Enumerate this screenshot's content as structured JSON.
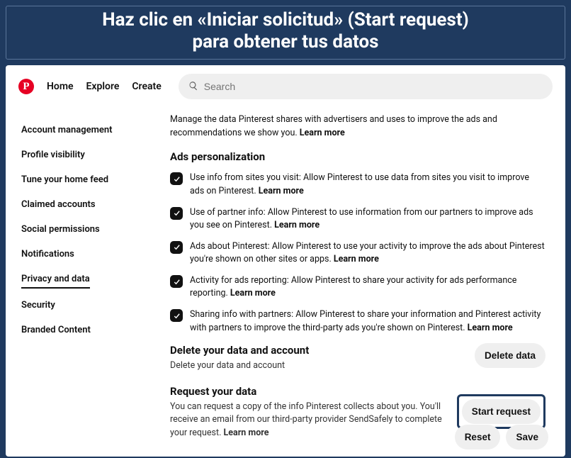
{
  "banner": {
    "line1": "Haz clic en «Iniciar solicitud» (Start request)",
    "line2": "para obtener tus datos"
  },
  "nav": {
    "home": "Home",
    "explore": "Explore",
    "create": "Create",
    "search_placeholder": "Search"
  },
  "sidebar": {
    "items": [
      {
        "label": "Account management"
      },
      {
        "label": "Profile visibility"
      },
      {
        "label": "Tune your home feed"
      },
      {
        "label": "Claimed accounts"
      },
      {
        "label": "Social permissions"
      },
      {
        "label": "Notifications"
      },
      {
        "label": "Privacy and data",
        "active": true
      },
      {
        "label": "Security"
      },
      {
        "label": "Branded Content"
      }
    ]
  },
  "content": {
    "intro": "Manage the data Pinterest shares with advertisers and uses to improve the ads and recommendations we show you.",
    "learn_more": "Learn more",
    "ads_h": "Ads personalization",
    "opts": [
      "Use info from sites you visit: Allow Pinterest to use data from sites you visit to improve ads on Pinterest.",
      "Use of partner info: Allow Pinterest to use information from our partners to improve ads you see on Pinterest.",
      "Ads about Pinterest: Allow Pinterest to use your activity to improve the ads about Pinterest you're shown on other sites or apps.",
      "Activity for ads reporting: Allow Pinterest to share your activity for ads performance reporting.",
      "Sharing info with partners: Allow Pinterest to share your information and Pinterest activity with partners to improve the third-party ads you're shown on Pinterest."
    ],
    "delete_h": "Delete your data and account",
    "delete_sub": "Delete your data and account",
    "delete_btn": "Delete data",
    "request_h": "Request your data",
    "request_desc": "You can request a copy of the info Pinterest collects about you. You'll receive an email from our third-party provider SendSafely to complete your request.",
    "request_btn": "Start request"
  },
  "footer": {
    "reset": "Reset",
    "save": "Save"
  }
}
